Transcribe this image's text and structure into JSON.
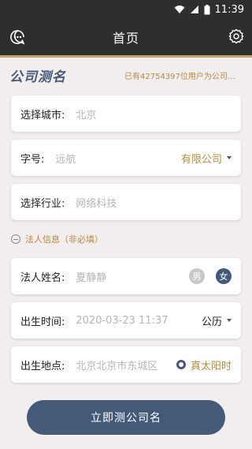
{
  "status": {
    "time": "11:39"
  },
  "header": {
    "title": "首页"
  },
  "brand": {
    "name": "公司测名"
  },
  "notice": "已有42754397位用户为公司起名",
  "form": {
    "city": {
      "label": "选择城市:",
      "value": "北京"
    },
    "name": {
      "label": "字号:",
      "value": "远航",
      "suffix": "有限公司"
    },
    "industry": {
      "label": "选择行业:",
      "value": "网络科技"
    },
    "legal_section": {
      "label": "法人信息（非必填）"
    },
    "person_name": {
      "label": "法人姓名:",
      "value": "夏静静",
      "male": "男",
      "female": "女"
    },
    "birth_time": {
      "label": "出生时间:",
      "value": "2020-03-23 11:37",
      "calendar": "公历"
    },
    "birth_place": {
      "label": "出生地点:",
      "value": "北京北京市东城区",
      "solar": "真太阳时"
    }
  },
  "submit": {
    "label": "立即测公司名"
  },
  "colors": {
    "accent": "#455a78",
    "gold": "#b68b3a",
    "bar": "#2e2e2e"
  }
}
